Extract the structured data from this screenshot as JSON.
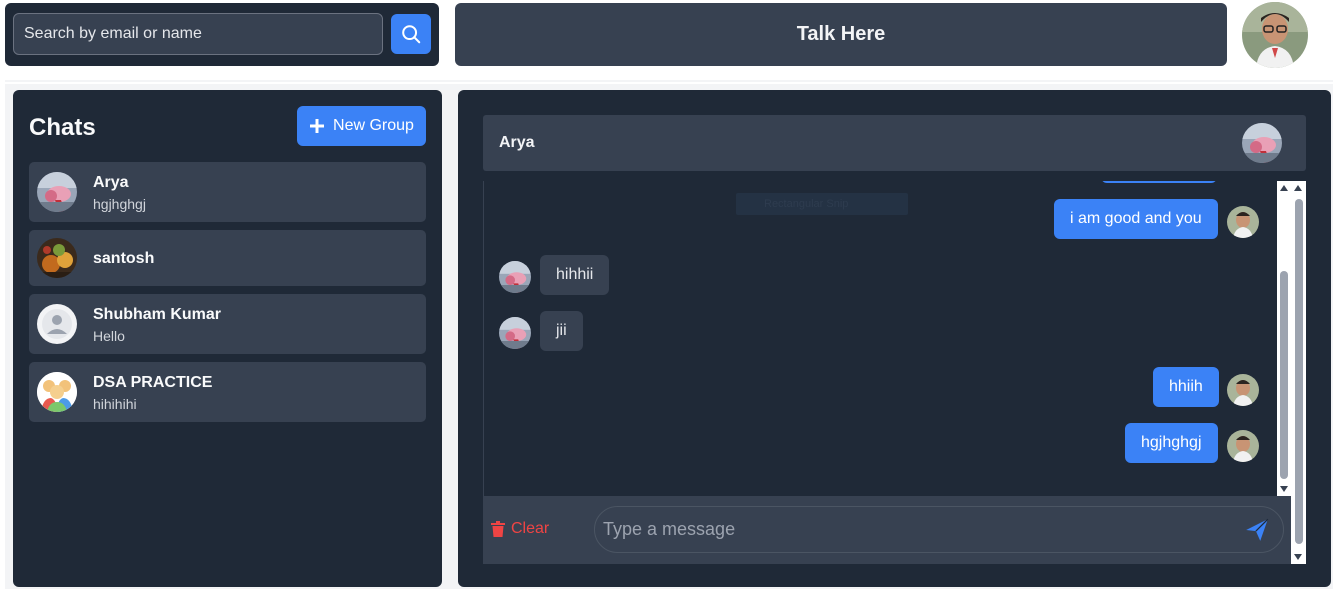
{
  "search": {
    "placeholder": "Search by email or name"
  },
  "header": {
    "title": "Talk Here"
  },
  "sidebar": {
    "title": "Chats",
    "new_group_label": "New Group",
    "chats": [
      {
        "name": "Arya",
        "last": "hgjhghgj"
      },
      {
        "name": "santosh",
        "last": ""
      },
      {
        "name": "Shubham Kumar",
        "last": "Hello"
      },
      {
        "name": "DSA PRACTICE",
        "last": "hihihihi"
      }
    ]
  },
  "chat": {
    "title": "Arya",
    "overlay_text": "Rectangular Snip",
    "messages": [
      {
        "from": "me",
        "text": "i am good and you"
      },
      {
        "from": "them",
        "text": "hihhii"
      },
      {
        "from": "them",
        "text": "jii"
      },
      {
        "from": "me",
        "text": "hhiih"
      },
      {
        "from": "me",
        "text": "hgjhghgj"
      }
    ]
  },
  "composer": {
    "clear_label": "Clear",
    "placeholder": "Type a message"
  },
  "colors": {
    "accent": "#3b82f6",
    "panel": "#1f2937",
    "card": "#374151",
    "danger": "#ef4444"
  }
}
